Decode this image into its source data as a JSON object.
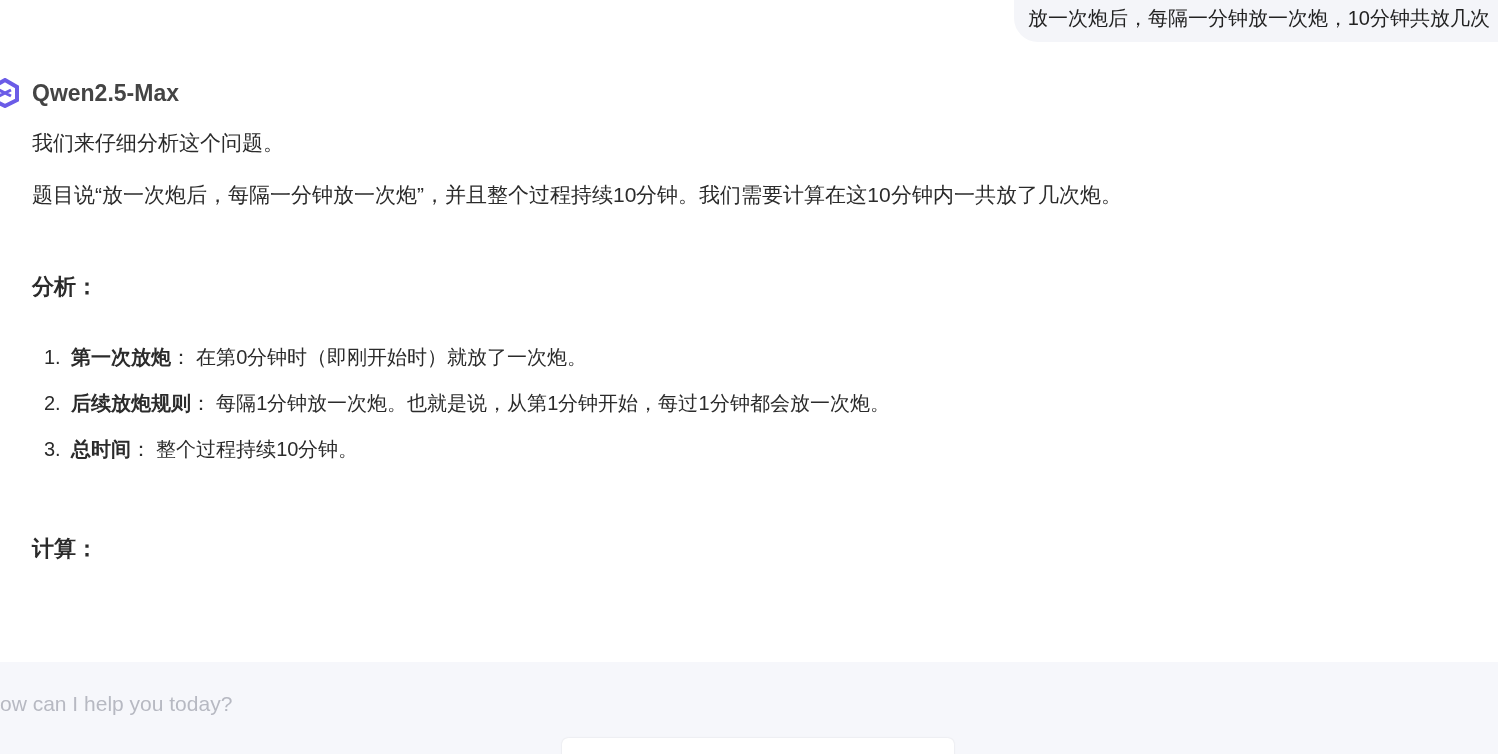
{
  "user_message": {
    "text": "放一次炮后，每隔一分钟放一次炮，10分钟共放几次"
  },
  "assistant": {
    "name": "Qwen2.5-Max",
    "paragraphs": [
      "我们来仔细分析这个问题。",
      "题目说“放一次炮后，每隔一分钟放一次炮”，并且整个过程持续10分钟。我们需要计算在这10分钟内一共放了几次炮。"
    ],
    "sections": [
      {
        "heading": "分析：",
        "items": [
          {
            "number": "1.",
            "text": "**第一次放炮**： 在第0分钟时（即刚开始时）就放了一次炮。"
          },
          {
            "number": "2.",
            "text": "**后续放炮规则**： 每隔1分钟放一次炮。也就是说，从第1分钟开始，每过1分钟都会放一次炮。"
          },
          {
            "number": "3.",
            "text": "**总时间**： 整个过程持续10分钟。"
          }
        ]
      },
      {
        "heading": "计算："
      }
    ]
  },
  "composer": {
    "placeholder": "ow can I help you today?"
  }
}
